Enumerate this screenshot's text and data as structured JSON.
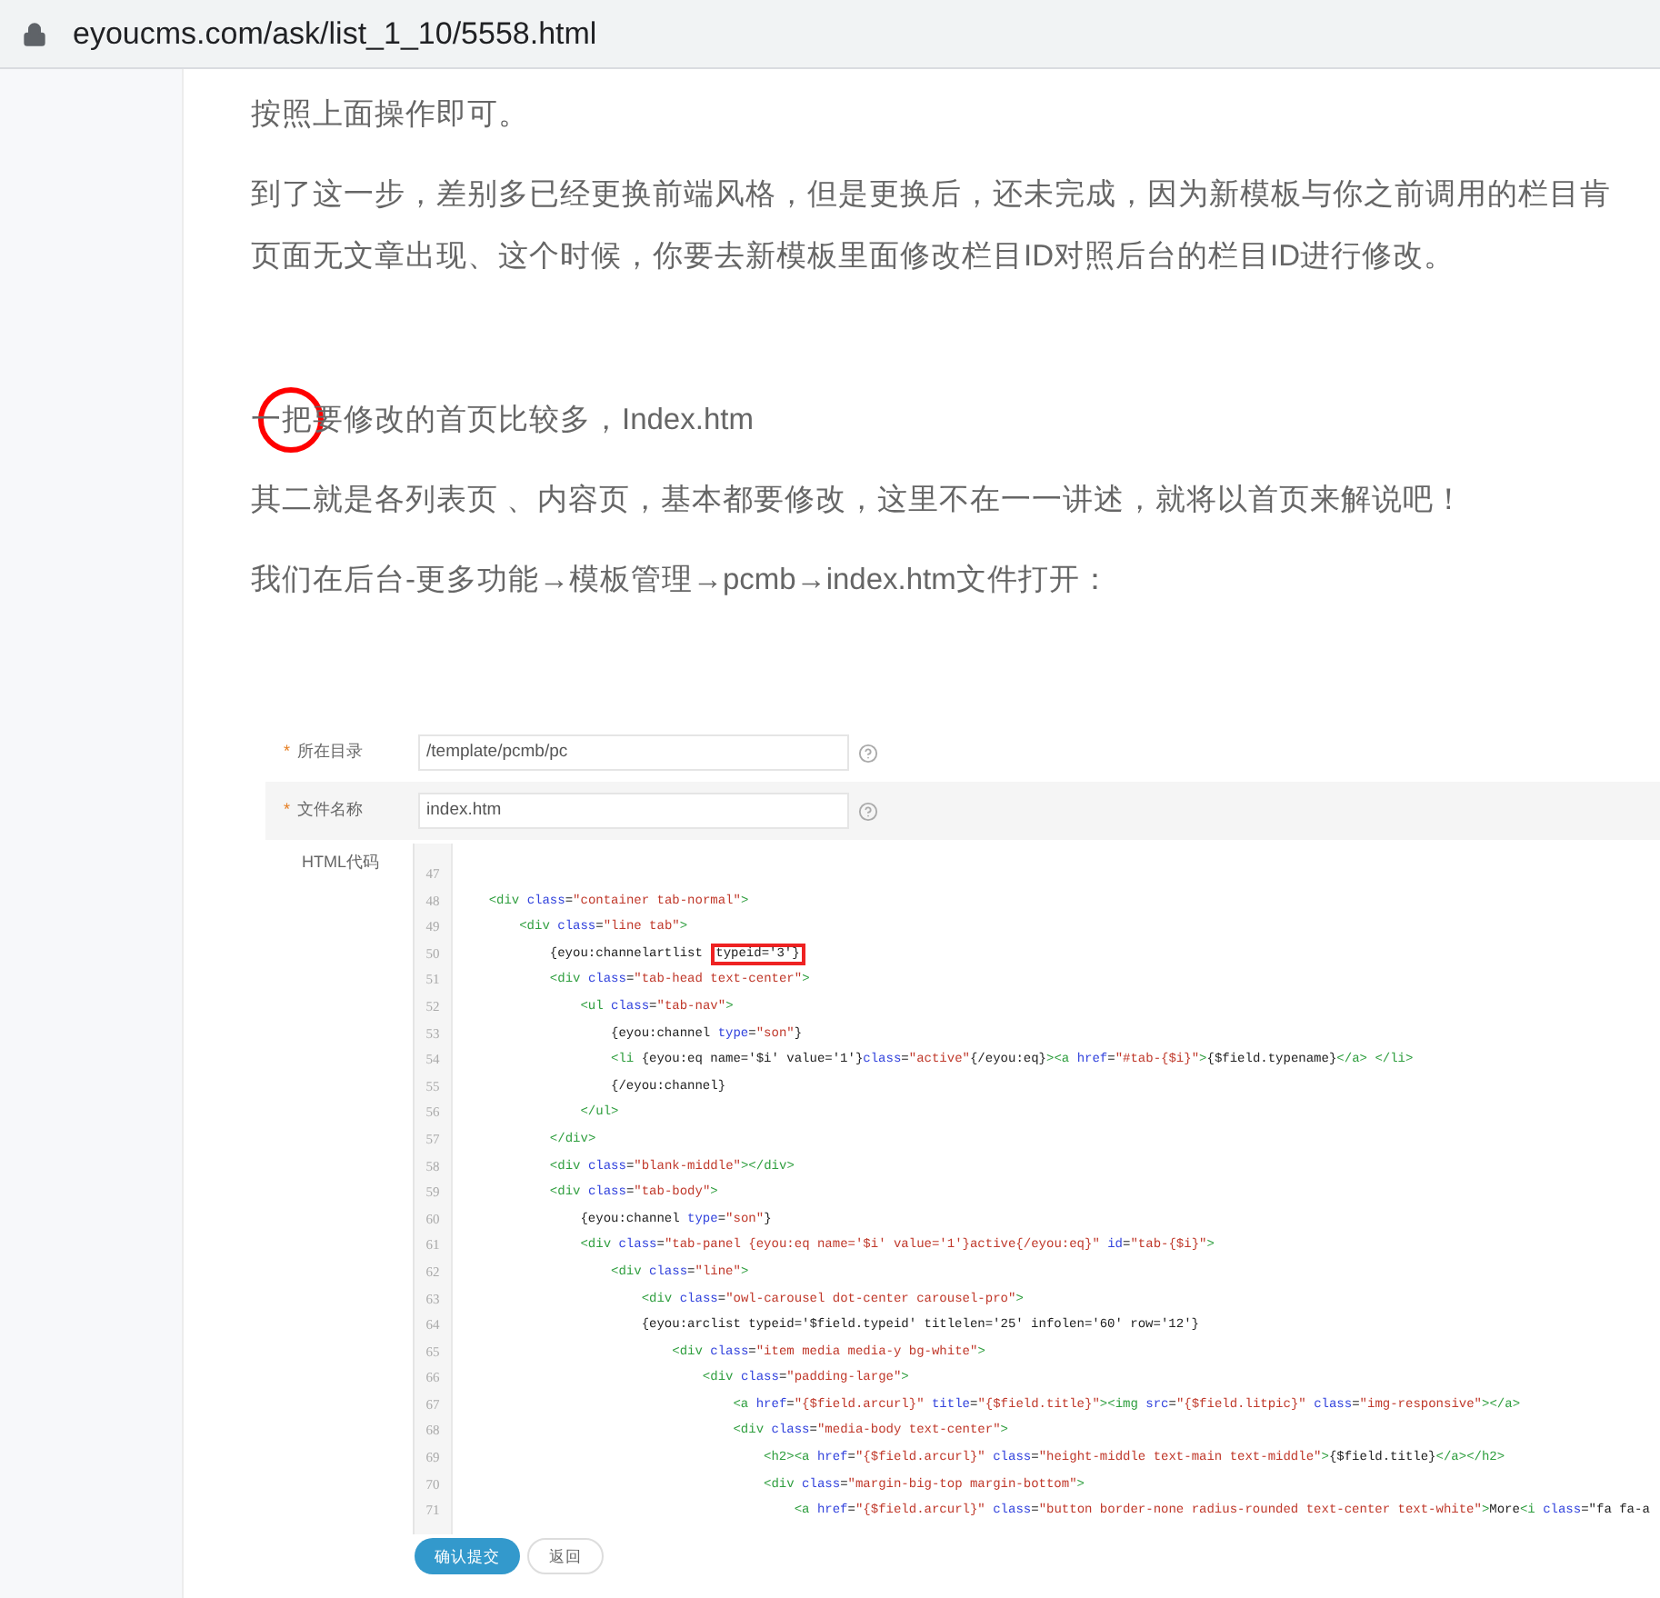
{
  "address_bar": {
    "url": "eyoucms.com/ask/list_1_10/5558.html"
  },
  "article": {
    "sections": [
      {
        "paragraphs": [
          {
            "lines": [
              "按照上面操作即可。"
            ]
          },
          {
            "lines": [
              "到了这一步，差别多已经更换前端风格，但是更换后，还未完成，因为新模板与你之前调用的栏目肯",
              "页面无文章出现、这个时候，你要去新模板里面修改栏目ID对照后台的栏目ID进行修改。"
            ]
          }
        ]
      },
      {
        "paragraphs": [
          {
            "lines": [
              "一把要修改的首页比较多，Index.htm"
            ],
            "circled": true
          },
          {
            "lines": [
              "其二就是各列表页 、内容页，基本都要修改，这里不在一一讲述，就将以首页来解说吧！"
            ]
          },
          {
            "lines": [
              "我们在后台-更多功能→模板管理→pcmb→index.htm文件打开："
            ]
          }
        ]
      }
    ]
  },
  "form": {
    "fields": [
      {
        "marker": "*",
        "label": "所在目录",
        "value": "/template/pcmb/pc"
      },
      {
        "marker": "*",
        "label": "文件名称",
        "value": "index.htm"
      }
    ],
    "code_label": "HTML代码",
    "code_lines": [
      {
        "number": "47"
      },
      {
        "number": "48",
        "text": "    <div class=\"container tab-normal\">"
      },
      {
        "number": "49",
        "text": "        <div class=\"line tab\">"
      },
      {
        "number": "50",
        "text": "            {eyou:channelartlist ",
        "highlight": "typeid='3'}"
      },
      {
        "number": "51",
        "text": "            <div class=\"tab-head text-center\">"
      },
      {
        "number": "52",
        "text": "                <ul class=\"tab-nav\">"
      },
      {
        "number": "53",
        "text": "                    {eyou:channel type=\"son\"}"
      },
      {
        "number": "54",
        "text": "                    <li {eyou:eq name='$i' value='1'}class=\"active\"{/eyou:eq}><a href=\"#tab-{$i}\">{$field.typename}</a> </li>"
      },
      {
        "number": "55",
        "text": "                    {/eyou:channel}"
      },
      {
        "number": "56",
        "text": "                </ul>"
      },
      {
        "number": "57",
        "text": "            </div>"
      },
      {
        "number": "58",
        "text": "            <div class=\"blank-middle\"></div>"
      },
      {
        "number": "59",
        "text": "            <div class=\"tab-body\">"
      },
      {
        "number": "60",
        "text": "                {eyou:channel type=\"son\"}"
      },
      {
        "number": "61",
        "text": "                <div class=\"tab-panel {eyou:eq name='$i' value='1'}active{/eyou:eq}\" id=\"tab-{$i}\">"
      },
      {
        "number": "62",
        "text": "                    <div class=\"line\">"
      },
      {
        "number": "63",
        "text": "                        <div class=\"owl-carousel dot-center carousel-pro\">"
      },
      {
        "number": "64",
        "text": "                        {eyou:arclist typeid='$field.typeid' titlelen='25' infolen='60' row='12'}"
      },
      {
        "number": "65",
        "text": "                            <div class=\"item media media-y bg-white\">"
      },
      {
        "number": "66",
        "text": "                                <div class=\"padding-large\">"
      },
      {
        "number": "67",
        "text": "                                    <a href=\"{$field.arcurl}\" title=\"{$field.title}\"><img src=\"{$field.litpic}\" class=\"img-responsive\"></a>"
      },
      {
        "number": "68",
        "text": "                                    <div class=\"media-body text-center\">"
      },
      {
        "number": "69",
        "text": "                                        <h2><a href=\"{$field.arcurl}\" class=\"height-middle text-main text-middle\">{$field.title}</a></h2>"
      },
      {
        "number": "70",
        "text": "                                        <div class=\"margin-big-top margin-bottom\">"
      },
      {
        "number": "71",
        "text": "                                            <a href=\"{$field.arcurl}\" class=\"button border-none radius-rounded text-center text-white\">More<i class=\"fa fa-a"
      }
    ],
    "buttons": [
      {
        "label": "确认提交",
        "kind": "primary"
      },
      {
        "label": "返回",
        "kind": "secondary"
      }
    ]
  }
}
